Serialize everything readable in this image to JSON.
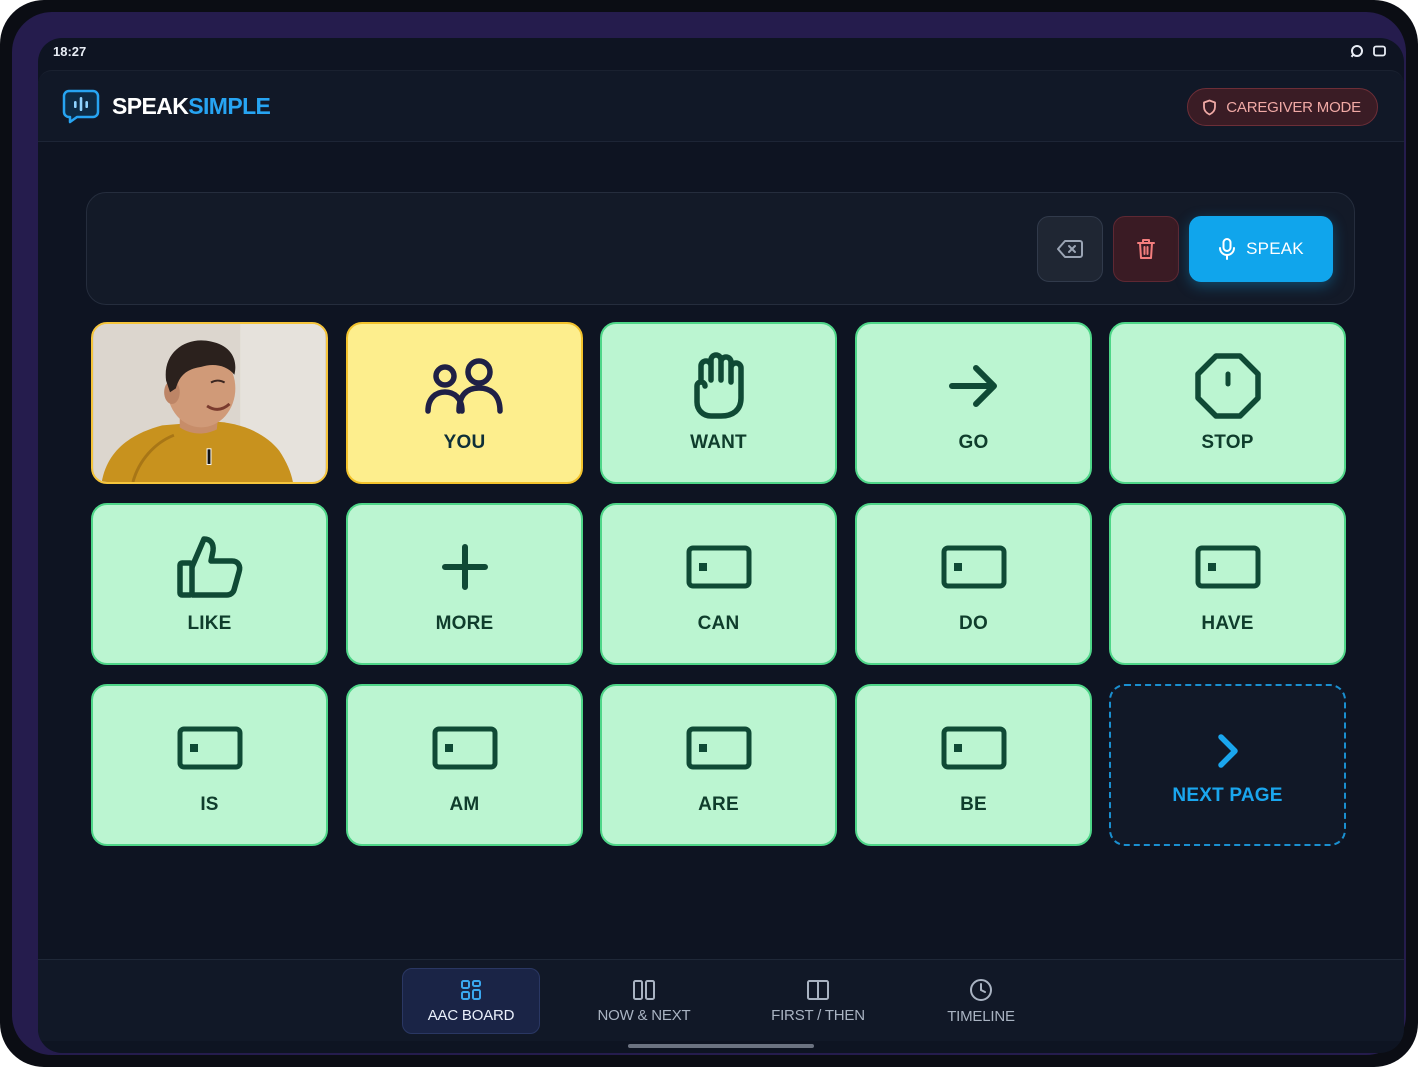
{
  "status_bar": {
    "time": "18:27",
    "icons": [
      "sync-icon",
      "window-icon"
    ]
  },
  "header": {
    "brand_part1": "SPEAK",
    "brand_part2": "SIMPLE",
    "caregiver_label": "CAREGIVER MODE"
  },
  "sentence_strip": {
    "text": "",
    "speak_label": "SPEAK"
  },
  "tiles": [
    {
      "label": "",
      "icon": "person-photo",
      "kind": "photo"
    },
    {
      "label": "YOU",
      "icon": "people-icon",
      "kind": "you"
    },
    {
      "label": "WANT",
      "icon": "hand-icon",
      "kind": "word"
    },
    {
      "label": "GO",
      "icon": "arrow-right-icon",
      "kind": "word"
    },
    {
      "label": "STOP",
      "icon": "octagon-icon",
      "kind": "word"
    },
    {
      "label": "LIKE",
      "icon": "thumbs-up-icon",
      "kind": "word"
    },
    {
      "label": "MORE",
      "icon": "plus-icon",
      "kind": "word"
    },
    {
      "label": "CAN",
      "icon": "placeholder-icon",
      "kind": "word"
    },
    {
      "label": "DO",
      "icon": "placeholder-icon",
      "kind": "word"
    },
    {
      "label": "HAVE",
      "icon": "placeholder-icon",
      "kind": "word"
    },
    {
      "label": "IS",
      "icon": "placeholder-icon",
      "kind": "word"
    },
    {
      "label": "AM",
      "icon": "placeholder-icon",
      "kind": "word"
    },
    {
      "label": "ARE",
      "icon": "placeholder-icon",
      "kind": "word"
    },
    {
      "label": "BE",
      "icon": "placeholder-icon",
      "kind": "word"
    },
    {
      "label": "NEXT PAGE",
      "icon": "chevron-right-icon",
      "kind": "next"
    }
  ],
  "bottom_nav": [
    {
      "label": "AAC BOARD",
      "icon": "grid-icon",
      "active": true
    },
    {
      "label": "NOW & NEXT",
      "icon": "columns-icon",
      "active": false
    },
    {
      "label": "FIRST / THEN",
      "icon": "book-icon",
      "active": false
    },
    {
      "label": "TIMELINE",
      "icon": "clock-icon",
      "active": false
    }
  ],
  "colors": {
    "accent": "#10a5ec",
    "tile_green": "#bbf5d1",
    "tile_yellow": "#fdee8d",
    "icon_dark_green": "#0f4a35"
  }
}
